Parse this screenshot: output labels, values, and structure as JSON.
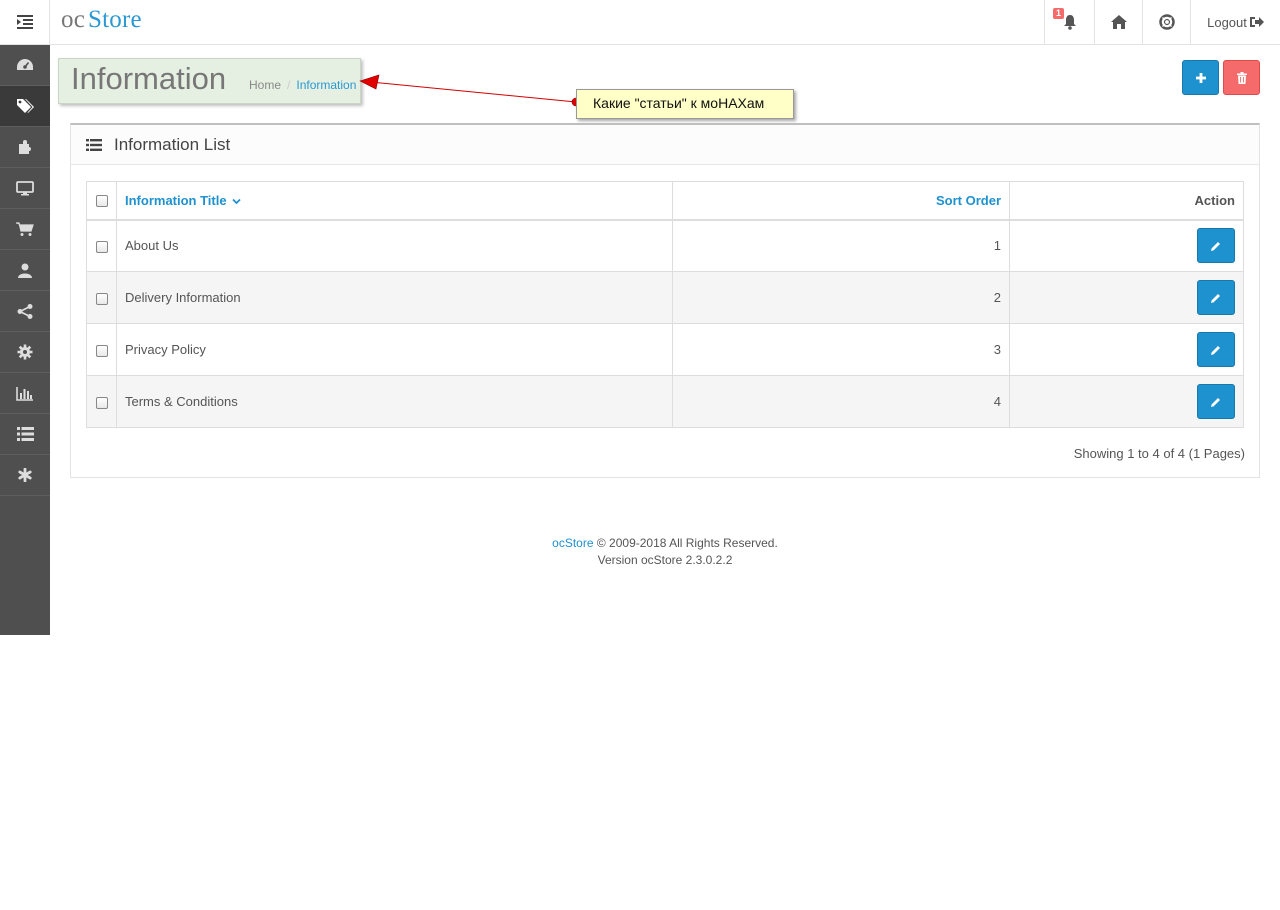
{
  "header": {
    "logo_a": "oc",
    "logo_b": "Store",
    "notification_count": "1",
    "logout_label": "Logout"
  },
  "sidebar": {
    "items": [
      {
        "icon": "dashboard-icon"
      },
      {
        "icon": "tags-icon",
        "active": true
      },
      {
        "icon": "puzzle-icon"
      },
      {
        "icon": "desktop-icon"
      },
      {
        "icon": "shopping-cart-icon"
      },
      {
        "icon": "user-icon"
      },
      {
        "icon": "share-icon"
      },
      {
        "icon": "cog-icon"
      },
      {
        "icon": "bar-chart-icon"
      },
      {
        "icon": "list-icon"
      },
      {
        "icon": "asterisk-icon"
      }
    ]
  },
  "page": {
    "title": "Information",
    "breadcrumb": {
      "home": "Home",
      "sep": "/",
      "current": "Information"
    }
  },
  "annotation": {
    "text": "Какие \"статьи\" к моНАХам"
  },
  "panel": {
    "title": "Information List",
    "columns": {
      "title": "Information Title",
      "sort": "Sort Order",
      "action": "Action"
    },
    "rows": [
      {
        "title": "About Us",
        "sort": "1"
      },
      {
        "title": "Delivery Information",
        "sort": "2"
      },
      {
        "title": "Privacy Policy",
        "sort": "3"
      },
      {
        "title": "Terms & Conditions",
        "sort": "4"
      }
    ],
    "pagination": "Showing 1 to 4 of 4 (1 Pages)"
  },
  "footer": {
    "brand": "ocStore",
    "copyright": " © 2009-2018 All Rights Reserved.",
    "version": "Version ocStore 2.3.0.2.2"
  },
  "colors": {
    "primary": "#1e91cf",
    "danger": "#f56b6b",
    "sidebar": "#4f4f4f"
  }
}
